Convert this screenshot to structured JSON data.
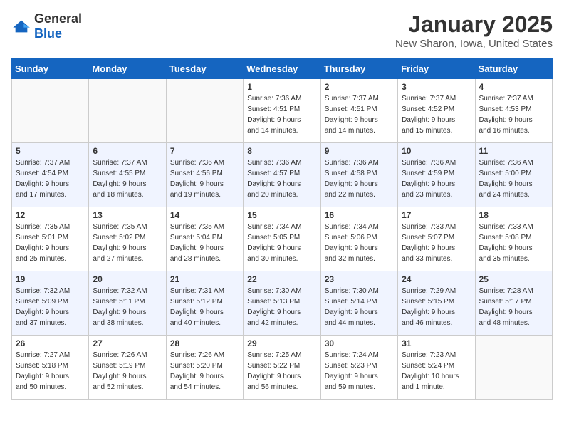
{
  "logo": {
    "general": "General",
    "blue": "Blue"
  },
  "title": "January 2025",
  "subtitle": "New Sharon, Iowa, United States",
  "headers": [
    "Sunday",
    "Monday",
    "Tuesday",
    "Wednesday",
    "Thursday",
    "Friday",
    "Saturday"
  ],
  "weeks": [
    [
      {
        "day": "",
        "info": ""
      },
      {
        "day": "",
        "info": ""
      },
      {
        "day": "",
        "info": ""
      },
      {
        "day": "1",
        "info": "Sunrise: 7:36 AM\nSunset: 4:51 PM\nDaylight: 9 hours\nand 14 minutes."
      },
      {
        "day": "2",
        "info": "Sunrise: 7:37 AM\nSunset: 4:51 PM\nDaylight: 9 hours\nand 14 minutes."
      },
      {
        "day": "3",
        "info": "Sunrise: 7:37 AM\nSunset: 4:52 PM\nDaylight: 9 hours\nand 15 minutes."
      },
      {
        "day": "4",
        "info": "Sunrise: 7:37 AM\nSunset: 4:53 PM\nDaylight: 9 hours\nand 16 minutes."
      }
    ],
    [
      {
        "day": "5",
        "info": "Sunrise: 7:37 AM\nSunset: 4:54 PM\nDaylight: 9 hours\nand 17 minutes."
      },
      {
        "day": "6",
        "info": "Sunrise: 7:37 AM\nSunset: 4:55 PM\nDaylight: 9 hours\nand 18 minutes."
      },
      {
        "day": "7",
        "info": "Sunrise: 7:36 AM\nSunset: 4:56 PM\nDaylight: 9 hours\nand 19 minutes."
      },
      {
        "day": "8",
        "info": "Sunrise: 7:36 AM\nSunset: 4:57 PM\nDaylight: 9 hours\nand 20 minutes."
      },
      {
        "day": "9",
        "info": "Sunrise: 7:36 AM\nSunset: 4:58 PM\nDaylight: 9 hours\nand 22 minutes."
      },
      {
        "day": "10",
        "info": "Sunrise: 7:36 AM\nSunset: 4:59 PM\nDaylight: 9 hours\nand 23 minutes."
      },
      {
        "day": "11",
        "info": "Sunrise: 7:36 AM\nSunset: 5:00 PM\nDaylight: 9 hours\nand 24 minutes."
      }
    ],
    [
      {
        "day": "12",
        "info": "Sunrise: 7:35 AM\nSunset: 5:01 PM\nDaylight: 9 hours\nand 25 minutes."
      },
      {
        "day": "13",
        "info": "Sunrise: 7:35 AM\nSunset: 5:02 PM\nDaylight: 9 hours\nand 27 minutes."
      },
      {
        "day": "14",
        "info": "Sunrise: 7:35 AM\nSunset: 5:04 PM\nDaylight: 9 hours\nand 28 minutes."
      },
      {
        "day": "15",
        "info": "Sunrise: 7:34 AM\nSunset: 5:05 PM\nDaylight: 9 hours\nand 30 minutes."
      },
      {
        "day": "16",
        "info": "Sunrise: 7:34 AM\nSunset: 5:06 PM\nDaylight: 9 hours\nand 32 minutes."
      },
      {
        "day": "17",
        "info": "Sunrise: 7:33 AM\nSunset: 5:07 PM\nDaylight: 9 hours\nand 33 minutes."
      },
      {
        "day": "18",
        "info": "Sunrise: 7:33 AM\nSunset: 5:08 PM\nDaylight: 9 hours\nand 35 minutes."
      }
    ],
    [
      {
        "day": "19",
        "info": "Sunrise: 7:32 AM\nSunset: 5:09 PM\nDaylight: 9 hours\nand 37 minutes."
      },
      {
        "day": "20",
        "info": "Sunrise: 7:32 AM\nSunset: 5:11 PM\nDaylight: 9 hours\nand 38 minutes."
      },
      {
        "day": "21",
        "info": "Sunrise: 7:31 AM\nSunset: 5:12 PM\nDaylight: 9 hours\nand 40 minutes."
      },
      {
        "day": "22",
        "info": "Sunrise: 7:30 AM\nSunset: 5:13 PM\nDaylight: 9 hours\nand 42 minutes."
      },
      {
        "day": "23",
        "info": "Sunrise: 7:30 AM\nSunset: 5:14 PM\nDaylight: 9 hours\nand 44 minutes."
      },
      {
        "day": "24",
        "info": "Sunrise: 7:29 AM\nSunset: 5:15 PM\nDaylight: 9 hours\nand 46 minutes."
      },
      {
        "day": "25",
        "info": "Sunrise: 7:28 AM\nSunset: 5:17 PM\nDaylight: 9 hours\nand 48 minutes."
      }
    ],
    [
      {
        "day": "26",
        "info": "Sunrise: 7:27 AM\nSunset: 5:18 PM\nDaylight: 9 hours\nand 50 minutes."
      },
      {
        "day": "27",
        "info": "Sunrise: 7:26 AM\nSunset: 5:19 PM\nDaylight: 9 hours\nand 52 minutes."
      },
      {
        "day": "28",
        "info": "Sunrise: 7:26 AM\nSunset: 5:20 PM\nDaylight: 9 hours\nand 54 minutes."
      },
      {
        "day": "29",
        "info": "Sunrise: 7:25 AM\nSunset: 5:22 PM\nDaylight: 9 hours\nand 56 minutes."
      },
      {
        "day": "30",
        "info": "Sunrise: 7:24 AM\nSunset: 5:23 PM\nDaylight: 9 hours\nand 59 minutes."
      },
      {
        "day": "31",
        "info": "Sunrise: 7:23 AM\nSunset: 5:24 PM\nDaylight: 10 hours\nand 1 minute."
      },
      {
        "day": "",
        "info": ""
      }
    ]
  ]
}
